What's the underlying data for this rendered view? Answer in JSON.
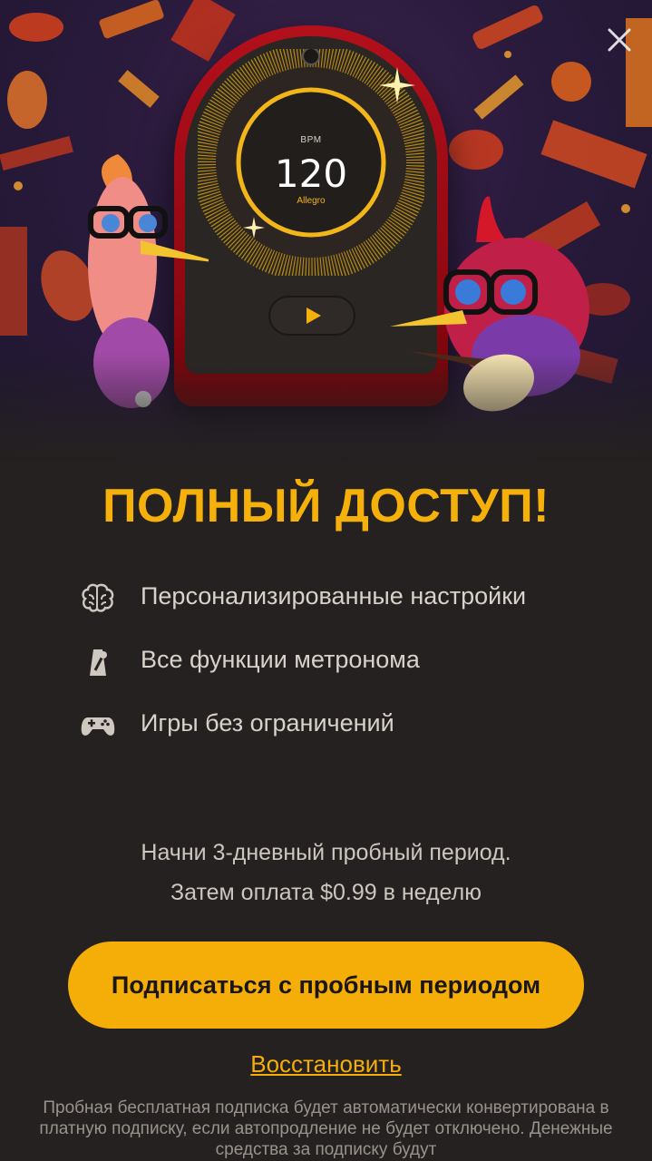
{
  "hero": {
    "bpm_label": "BPM",
    "bpm_value": "120",
    "tempo_name": "Allegro"
  },
  "title": "ПОЛНЫЙ ДОСТУП!",
  "features": [
    {
      "icon": "brain-icon",
      "label": "Персонализированные настройки"
    },
    {
      "icon": "metronome-icon",
      "label": "Все функции метронома"
    },
    {
      "icon": "gamepad-icon",
      "label": "Игры без ограничений"
    }
  ],
  "trial": {
    "line1": "Начни 3-дневный пробный период.",
    "line2": "Затем оплата $0.99 в неделю"
  },
  "cta_label": "Подписаться с пробным периодом",
  "restore_label": "Восстановить",
  "fine_print": "Пробная бесплатная подписка будет автоматически конвертирована в платную подписку, если автопродление не будет отключено. Денежные средства за подписку будут",
  "colors": {
    "accent": "#f5ad08",
    "background": "#252120",
    "device_red": "#b3101b"
  }
}
